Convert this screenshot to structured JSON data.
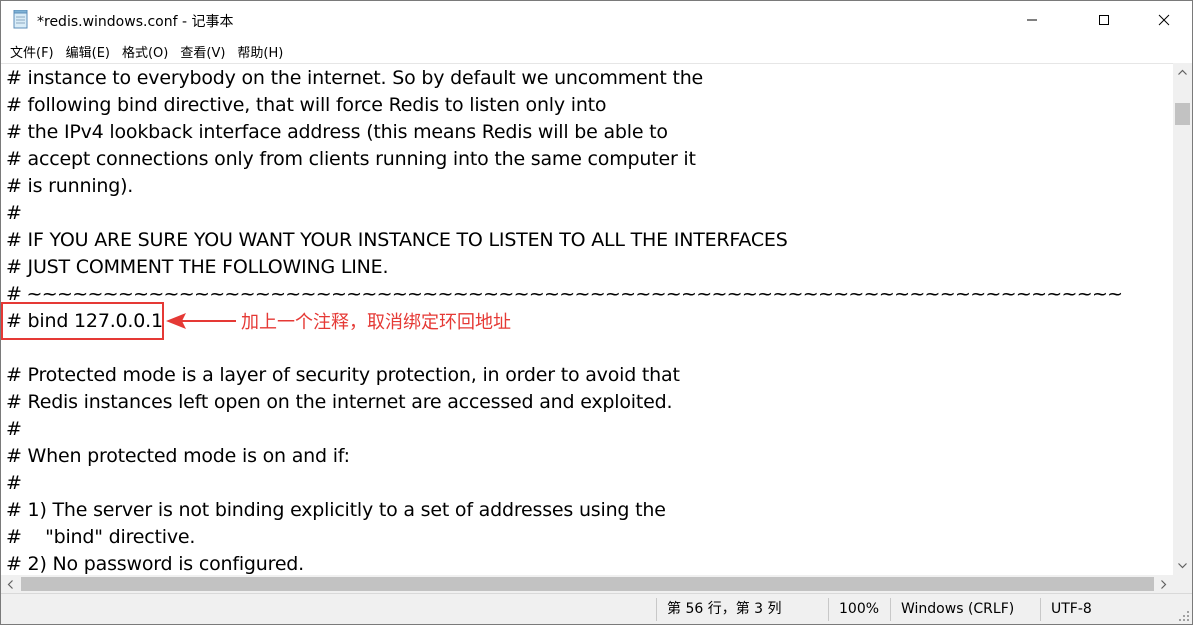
{
  "window": {
    "title": "*redis.windows.conf - 记事本",
    "controls": {
      "minimize": "—",
      "maximize": "☐",
      "close": "✕"
    }
  },
  "menu": {
    "items": [
      {
        "label": "文件(F)"
      },
      {
        "label": "编辑(E)"
      },
      {
        "label": "格式(O)"
      },
      {
        "label": "查看(V)"
      },
      {
        "label": "帮助(H)"
      }
    ]
  },
  "editor": {
    "lines": [
      "# instance to everybody on the internet. So by default we uncomment the",
      "# following bind directive, that will force Redis to listen only into",
      "# the IPv4 lookback interface address (this means Redis will be able to",
      "# accept connections only from clients running into the same computer it",
      "# is running).",
      "#",
      "# IF YOU ARE SURE YOU WANT YOUR INSTANCE TO LISTEN TO ALL THE INTERFACES",
      "# JUST COMMENT THE FOLLOWING LINE.",
      "# ~~~~~~~~~~~~~~~~~~~~~~~~~~~~~~~~~~~~~~~~~~~~~~~~~~~~~~~~~~~~~~~~~~~~~~~~",
      "# bind 127.0.0.1",
      "",
      "# Protected mode is a layer of security protection, in order to avoid that",
      "# Redis instances left open on the internet are accessed and exploited.",
      "#",
      "# When protected mode is on and if:",
      "#",
      "# 1) The server is not binding explicitly to a set of addresses using the",
      "#    \"bind\" directive.",
      "# 2) No password is configured."
    ]
  },
  "annotation": {
    "text": "加上一个注释，取消绑定环回地址",
    "color": "#e53935"
  },
  "statusbar": {
    "position": "第 56 行，第 3 列",
    "zoom": "100%",
    "line_ending": "Windows (CRLF)",
    "encoding": "UTF-8"
  }
}
